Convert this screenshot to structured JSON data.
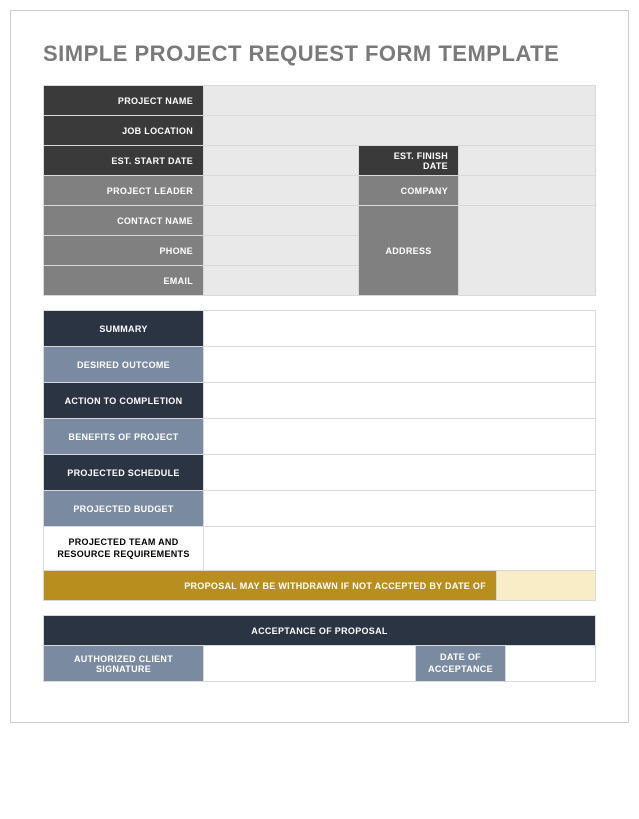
{
  "title": "SIMPLE PROJECT REQUEST FORM TEMPLATE",
  "section1": {
    "project_name": "PROJECT NAME",
    "job_location": "JOB LOCATION",
    "est_start_date": "EST. START DATE",
    "est_finish_date": "EST. FINISH DATE",
    "project_leader": "PROJECT LEADER",
    "company": "COMPANY",
    "contact_name": "CONTACT NAME",
    "phone": "PHONE",
    "email": "EMAIL",
    "address": "ADDRESS"
  },
  "section2": {
    "summary": "SUMMARY",
    "desired_outcome": "DESIRED OUTCOME",
    "action_to_completion": "ACTION TO COMPLETION",
    "benefits_of_project": "BENEFITS OF PROJECT",
    "projected_schedule": "PROJECTED SCHEDULE",
    "projected_budget": "PROJECTED BUDGET",
    "projected_team": "PROJECTED TEAM AND RESOURCE REQUIREMENTS",
    "withdraw_notice": "PROPOSAL MAY BE WITHDRAWN IF NOT ACCEPTED BY DATE OF"
  },
  "section3": {
    "acceptance": "ACCEPTANCE OF PROPOSAL",
    "signature": "AUTHORIZED CLIENT SIGNATURE",
    "date_of_acceptance": "DATE OF ACCEPTANCE"
  }
}
